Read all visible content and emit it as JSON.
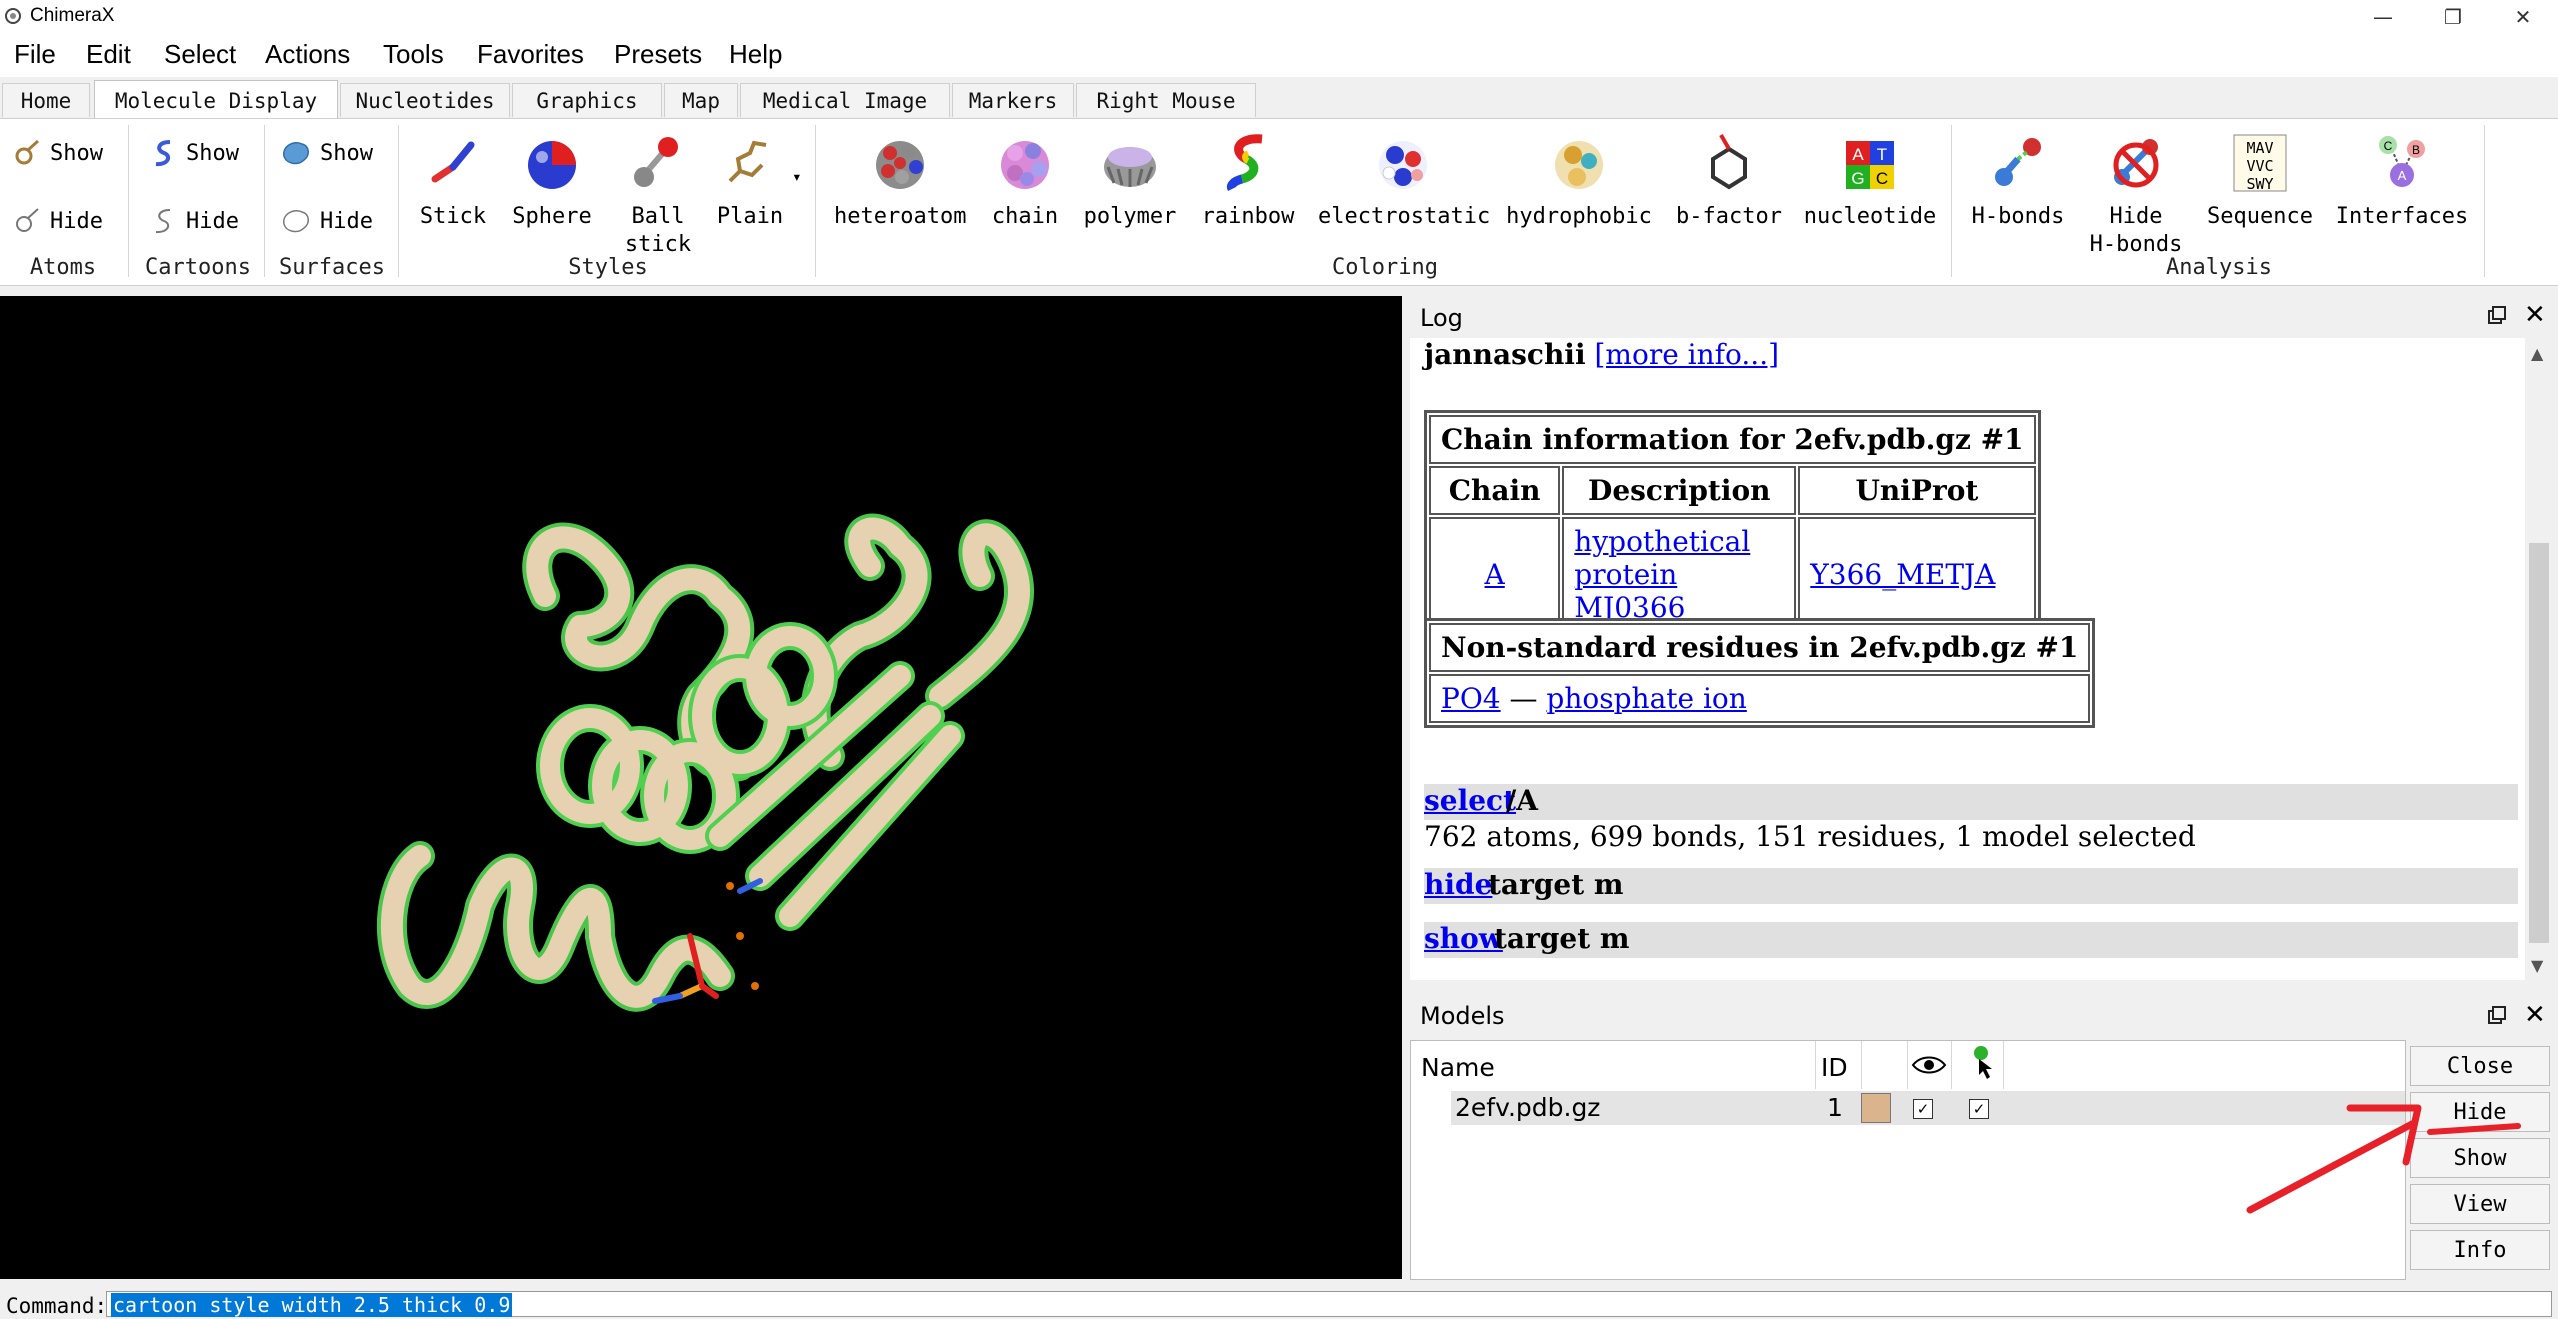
{
  "window": {
    "title": "ChimeraX"
  },
  "menubar": [
    "File",
    "Edit",
    "Select",
    "Actions",
    "Tools",
    "Favorites",
    "Presets",
    "Help"
  ],
  "tabs": [
    "Home",
    "Molecule Display",
    "Nucleotides",
    "Graphics",
    "Map",
    "Medical Image",
    "Markers",
    "Right Mouse"
  ],
  "active_tab": "Molecule Display",
  "ribbon": {
    "atoms": {
      "show": "Show",
      "hide": "Hide",
      "group": "Atoms"
    },
    "cartoons": {
      "show": "Show",
      "hide": "Hide",
      "group": "Cartoons"
    },
    "surfaces": {
      "show": "Show",
      "hide": "Hide",
      "group": "Surfaces"
    },
    "styles": {
      "group": "Styles",
      "stick": "Stick",
      "sphere": "Sphere",
      "ball1": "Ball",
      "ball2": "stick",
      "plain": "Plain"
    },
    "coloring": {
      "group": "Coloring",
      "heteroatom": "heteroatom",
      "chain": "chain",
      "polymer": "polymer",
      "rainbow": "rainbow",
      "electrostatic": "electrostatic",
      "hydrophobic": "hydrophobic",
      "bfactor": "b-factor",
      "nucleotide": "nucleotide"
    },
    "analysis": {
      "group": "Analysis",
      "hbonds": "H-bonds",
      "hide_hbonds1": "Hide",
      "hide_hbonds2": "H-bonds",
      "sequence": "Sequence",
      "interfaces": "Interfaces"
    }
  },
  "log": {
    "title": "Log",
    "organism": "jannaschii",
    "more_info": "[more info...]",
    "chain_table": {
      "caption": "Chain information for 2efv.pdb.gz #1",
      "headers": [
        "Chain",
        "Description",
        "UniProt"
      ],
      "row": [
        "A",
        "hypothetical protein MJ0366",
        "Y366_METJA"
      ]
    },
    "nonstd_table": {
      "caption": "Non-standard residues in 2efv.pdb.gz #1",
      "code": "PO4",
      "dash": "—",
      "name": "phosphate ion"
    },
    "commands": [
      {
        "cmd": "select",
        "args": "/A"
      },
      {
        "cmd": "hide",
        "args": "target m"
      },
      {
        "cmd": "show",
        "args": "target m"
      }
    ],
    "selection_result": "762 atoms, 699 bonds, 151 residues, 1 model selected"
  },
  "models": {
    "title": "Models",
    "headers": {
      "name": "Name",
      "id": "ID"
    },
    "row": {
      "name": "2efv.pdb.gz",
      "id": "1",
      "color": "#d9b48c"
    },
    "buttons": [
      "Close",
      "Hide",
      "Show",
      "View",
      "Info"
    ]
  },
  "command": {
    "label": "Command:",
    "value": "cartoon style width 2.5 thick 0.9"
  },
  "colors": {
    "selection_outline": "#4fd04f",
    "cartoon": "#e6d2b0",
    "annotation": "#e8202a",
    "link": "#0000ee"
  }
}
